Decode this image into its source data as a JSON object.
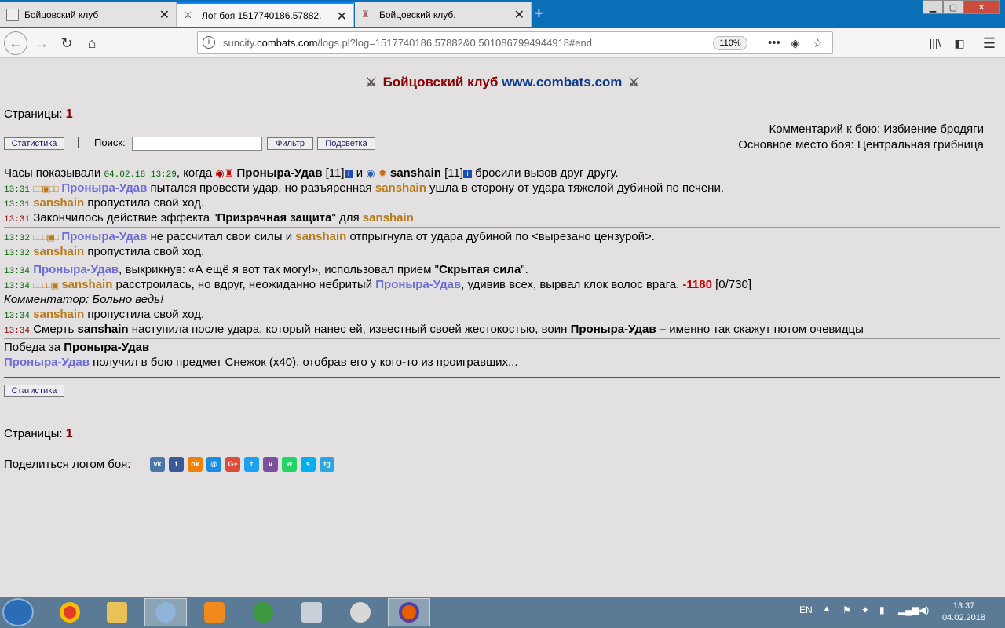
{
  "browser": {
    "tabs": [
      {
        "title": "Бойцовский клуб"
      },
      {
        "title": "Лог боя 1517740186.57882."
      },
      {
        "title": "Бойцовский клуб."
      }
    ],
    "url": {
      "prefix": "suncity.",
      "domain": "combats.com",
      "path": "/logs.pl?log=1517740186.57882&0.5010867994944918#end"
    },
    "zoom": "110%"
  },
  "page": {
    "title_red": "Бойцовский клуб",
    "title_blue": "www.combats.com",
    "pages_label": "Страницы:",
    "pages_num": "1",
    "buttons": {
      "stats": "Статистика",
      "filter": "Фильтр",
      "highlight": "Подсветка"
    },
    "separator": "|",
    "search_label": "Поиск:",
    "comment_line": "Комментарий к бою: Избиение бродяги",
    "place_line": "Основное место боя: Центральная грибница",
    "p1": "Проныра-Удав",
    "p2": "sanshain",
    "log": {
      "l0a": "Часы показывали",
      "l0time": "04.02.18 13:29",
      "l0b": ", когда",
      "l0lvl1": "[11]",
      "l0and": "и",
      "l0lvl2": "[11]",
      "l0c": "бросили вызов друг другу.",
      "t1": "13:31",
      "l1a": "пытался провести удар, но разъяренная",
      "l1b": "ушла в сторону от удара тяжелой дубиной по печени.",
      "l2": "пропустила свой ход.",
      "l3a": "Закончилось действие эффекта \"",
      "l3b": "Призрачная защита",
      "l3c": "\" для",
      "t2": "13:32",
      "l4a": "не рассчитал свои силы и",
      "l4b": "отпрыгнула от удара дубиной по <вырезано цензурой>.",
      "t3": "13:34",
      "l6a": ", выкрикнув: «А ещё я вот так могу!», использовал прием \"",
      "l6b": "Скрытая сила",
      "l6c": "\".",
      "l7a": "расстроилась, но вдруг, неожиданно небритый",
      "l7b": ", удивив всех, вырвал клок волос врага.",
      "l7dmg": "-1180",
      "l7hp": "[0/730]",
      "l8": "Комментатор: Больно ведь!",
      "l10a": "Смерть",
      "l10b": "наступила после удара, который нанес ей, известный своей жестокостью, воин",
      "l10c": "– именно так скажут потом очевидцы",
      "win_a": "Победа за",
      "loot": "получил в бою предмет Снежок (x40), отобрав его у кого-то из проигравших..."
    },
    "share_label": "Поделиться логом боя:",
    "social": [
      {
        "name": "vk",
        "label": "vk",
        "color": "#4a76a8"
      },
      {
        "name": "facebook",
        "label": "f",
        "color": "#3b5998"
      },
      {
        "name": "odnoklassniki",
        "label": "ok",
        "color": "#ee8208"
      },
      {
        "name": "moimir",
        "label": "@",
        "color": "#168de2"
      },
      {
        "name": "googleplus",
        "label": "G+",
        "color": "#dd4b39"
      },
      {
        "name": "twitter",
        "label": "t",
        "color": "#1da1f2"
      },
      {
        "name": "viber",
        "label": "v",
        "color": "#7b519d"
      },
      {
        "name": "whatsapp",
        "label": "w",
        "color": "#25d366"
      },
      {
        "name": "skype",
        "label": "s",
        "color": "#00aff0"
      },
      {
        "name": "telegram",
        "label": "tg",
        "color": "#2ca5e0"
      }
    ]
  },
  "taskbar": {
    "lang": "EN",
    "time": "13:37",
    "date": "04.02.2018"
  }
}
